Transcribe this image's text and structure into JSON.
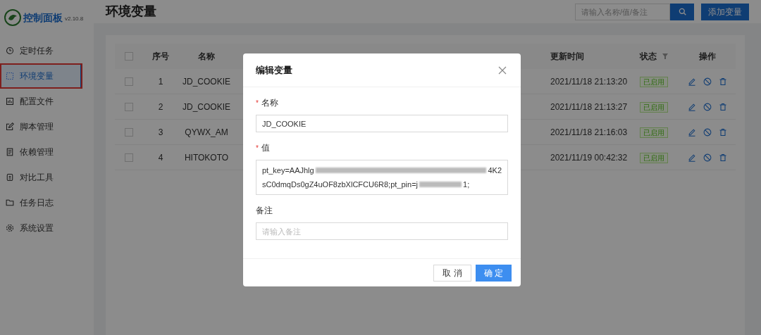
{
  "app": {
    "title": "控制面板",
    "version": "v2.10.8"
  },
  "sidebar": {
    "items": [
      {
        "label": "定时任务",
        "selected": false,
        "highlighted": false
      },
      {
        "label": "环境变量",
        "selected": true,
        "highlighted": true
      },
      {
        "label": "配置文件",
        "selected": false,
        "highlighted": false
      },
      {
        "label": "脚本管理",
        "selected": false,
        "highlighted": false
      },
      {
        "label": "依赖管理",
        "selected": false,
        "highlighted": false
      },
      {
        "label": "对比工具",
        "selected": false,
        "highlighted": false
      },
      {
        "label": "任务日志",
        "selected": false,
        "highlighted": false
      },
      {
        "label": "系统设置",
        "selected": false,
        "highlighted": false
      }
    ]
  },
  "page": {
    "title": "环境变量",
    "search": {
      "placeholder": "请输入名称/值/备注"
    },
    "add_button": "添加变量"
  },
  "table": {
    "header_checked": false,
    "columns": {
      "index": "序号",
      "name": "名称",
      "updated": "更新时间",
      "status": "状态",
      "actions": "操作"
    },
    "rows": [
      {
        "index": "1",
        "name": "JD_COOKIE",
        "updated": "2021/11/18 21:13:20",
        "status": "已启用",
        "checked": false
      },
      {
        "index": "2",
        "name": "JD_COOKIE",
        "updated": "2021/11/18 21:13:27",
        "status": "已启用",
        "checked": false
      },
      {
        "index": "3",
        "name": "QYWX_AM",
        "updated": "2021/11/18 21:16:03",
        "status": "已启用",
        "checked": false
      },
      {
        "index": "4",
        "name": "HITOKOTO",
        "updated": "2021/11/19 00:42:32",
        "status": "已启用",
        "checked": false
      }
    ]
  },
  "dialog": {
    "title": "编辑变量",
    "fields": [
      {
        "label": "名称",
        "marker": "*",
        "kind": "input",
        "value": "JD_COOKIE"
      },
      {
        "label": "值",
        "marker": "*",
        "kind": "textarea",
        "lines": [
          [
            {
              "kind": "text",
              "text": "pt_key=AAJhlg"
            },
            {
              "kind": "redacted"
            },
            {
              "kind": "text",
              "text": "4K2"
            }
          ],
          [
            {
              "kind": "text",
              "text": "sC0dmqDs0gZ4uOF8zbXlCFCU6R8;pt_pin=j"
            },
            {
              "kind": "redacted"
            },
            {
              "kind": "text",
              "text": "1;"
            }
          ]
        ]
      },
      {
        "label": "备注",
        "kind": "input",
        "placeholder": "请输入备注"
      }
    ],
    "cancel": "取 消",
    "ok": "确 定"
  }
}
